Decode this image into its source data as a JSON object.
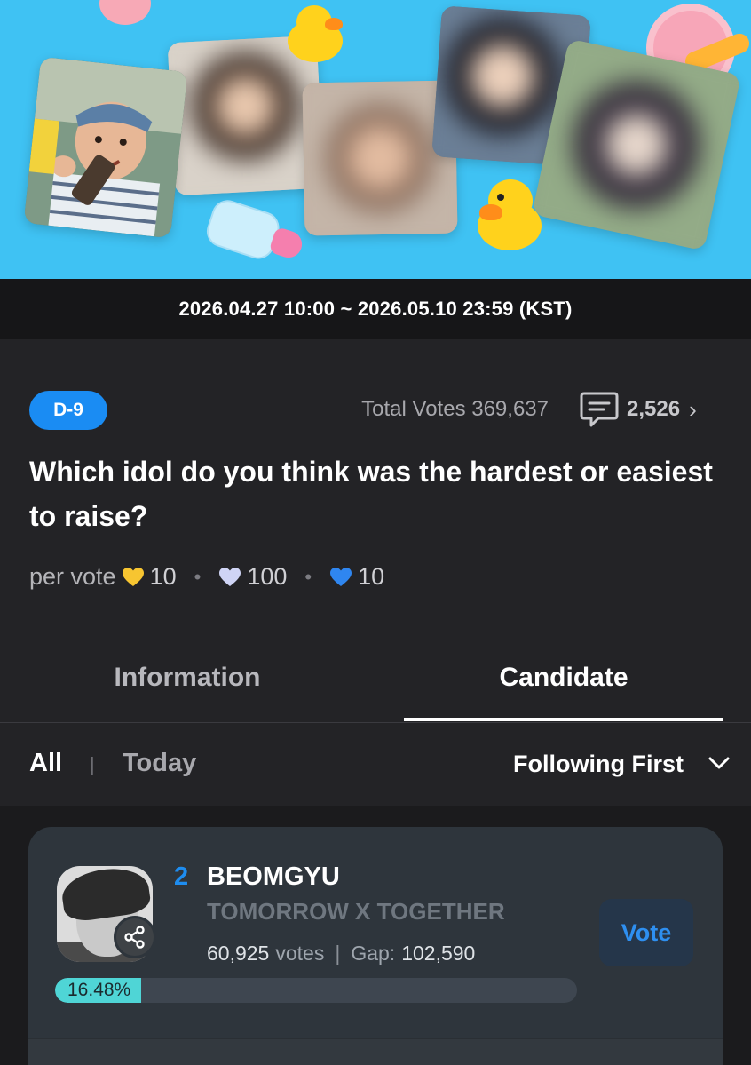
{
  "period": "2026.04.27 10:00 ~ 2026.05.10 23:59 (KST)",
  "vote": {
    "dday": "D-9",
    "total_votes_label": "Total Votes 369,637",
    "comment_count": "2,526",
    "question": "Which idol do you think was the hardest or easiest to raise?",
    "per_vote_label": "per vote",
    "costs": [
      {
        "amount": "10",
        "color": "#f7c531",
        "icon": "gold-heart-icon"
      },
      {
        "amount": "100",
        "color": "#cfd4f5",
        "icon": "lavender-heart-icon"
      },
      {
        "amount": "10",
        "color": "#2f86f0",
        "icon": "blue-heart-icon"
      }
    ]
  },
  "tabs": [
    {
      "label": "Information",
      "active": false
    },
    {
      "label": "Candidate",
      "active": true
    }
  ],
  "filters": {
    "all": "All",
    "today": "Today",
    "sort": "Following First"
  },
  "candidate": {
    "rank": "2",
    "name": "BEOMGYU",
    "group": "TOMORROW X TOGETHER",
    "votes": "60,925",
    "votes_suffix": "votes",
    "gap_label": "Gap:",
    "gap": "102,590",
    "vote_button": "Vote",
    "percent": 16.48,
    "percent_label": "16.48%"
  },
  "colors": {
    "banner": "#3fc2f3",
    "accent": "#1a8cf3",
    "progress": "#4fd5d6"
  }
}
